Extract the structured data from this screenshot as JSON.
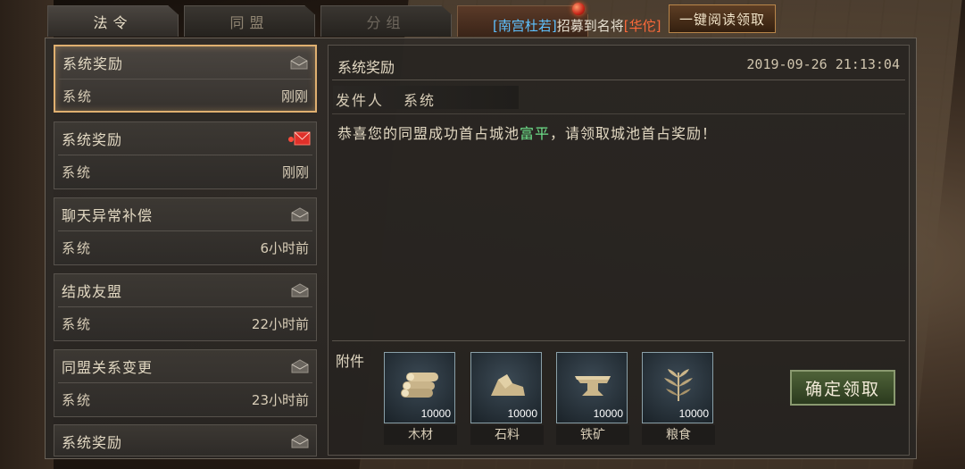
{
  "tabs": [
    {
      "label": "法令",
      "state": "active"
    },
    {
      "label": "同盟",
      "state": "normal"
    },
    {
      "label": "分组",
      "state": "disabled"
    },
    {
      "label": "",
      "state": "highlight"
    }
  ],
  "announcement": {
    "name1": "[南宫杜若]",
    "text": "招募到名将",
    "name2": "[华佗]"
  },
  "read_all_button": "一键阅读领取",
  "mail_list": [
    {
      "title": "系统奖励",
      "sender": "系统",
      "time": "刚刚",
      "icon": "envelope-opened-icon",
      "selected": true
    },
    {
      "title": "系统奖励",
      "sender": "系统",
      "time": "刚刚",
      "icon": "envelope-unread-icon",
      "selected": false
    },
    {
      "title": "聊天异常补偿",
      "sender": "系统",
      "time": "6小时前",
      "icon": "envelope-opened-icon",
      "selected": false
    },
    {
      "title": "结成友盟",
      "sender": "系统",
      "time": "22小时前",
      "icon": "envelope-opened-icon",
      "selected": false
    },
    {
      "title": "同盟关系变更",
      "sender": "系统",
      "time": "23小时前",
      "icon": "envelope-opened-icon",
      "selected": false
    },
    {
      "title": "系统奖励",
      "sender": "",
      "time": "",
      "icon": "envelope-opened-icon",
      "selected": false
    }
  ],
  "detail": {
    "title": "系统奖励",
    "datetime": "2019-09-26 21:13:04",
    "sender_label": "发件人",
    "sender": "系统",
    "body_prefix": "恭喜您的同盟成功首占城池",
    "city": "富平",
    "body_suffix": "，请领取城池首占奖励！",
    "attachments_label": "附件",
    "attachments": [
      {
        "name": "木材",
        "count": "10000",
        "icon": "wood-icon"
      },
      {
        "name": "石料",
        "count": "10000",
        "icon": "stone-icon"
      },
      {
        "name": "铁矿",
        "count": "10000",
        "icon": "iron-icon"
      },
      {
        "name": "粮食",
        "count": "10000",
        "icon": "grain-icon"
      }
    ],
    "claim_button": "确定领取"
  },
  "colors": {
    "accent_gold": "#e0b070",
    "city_green": "#6ee08a",
    "name_blue": "#5ec1ff",
    "name_orange": "#ff6a3a",
    "claim_green": "#4f6238"
  }
}
